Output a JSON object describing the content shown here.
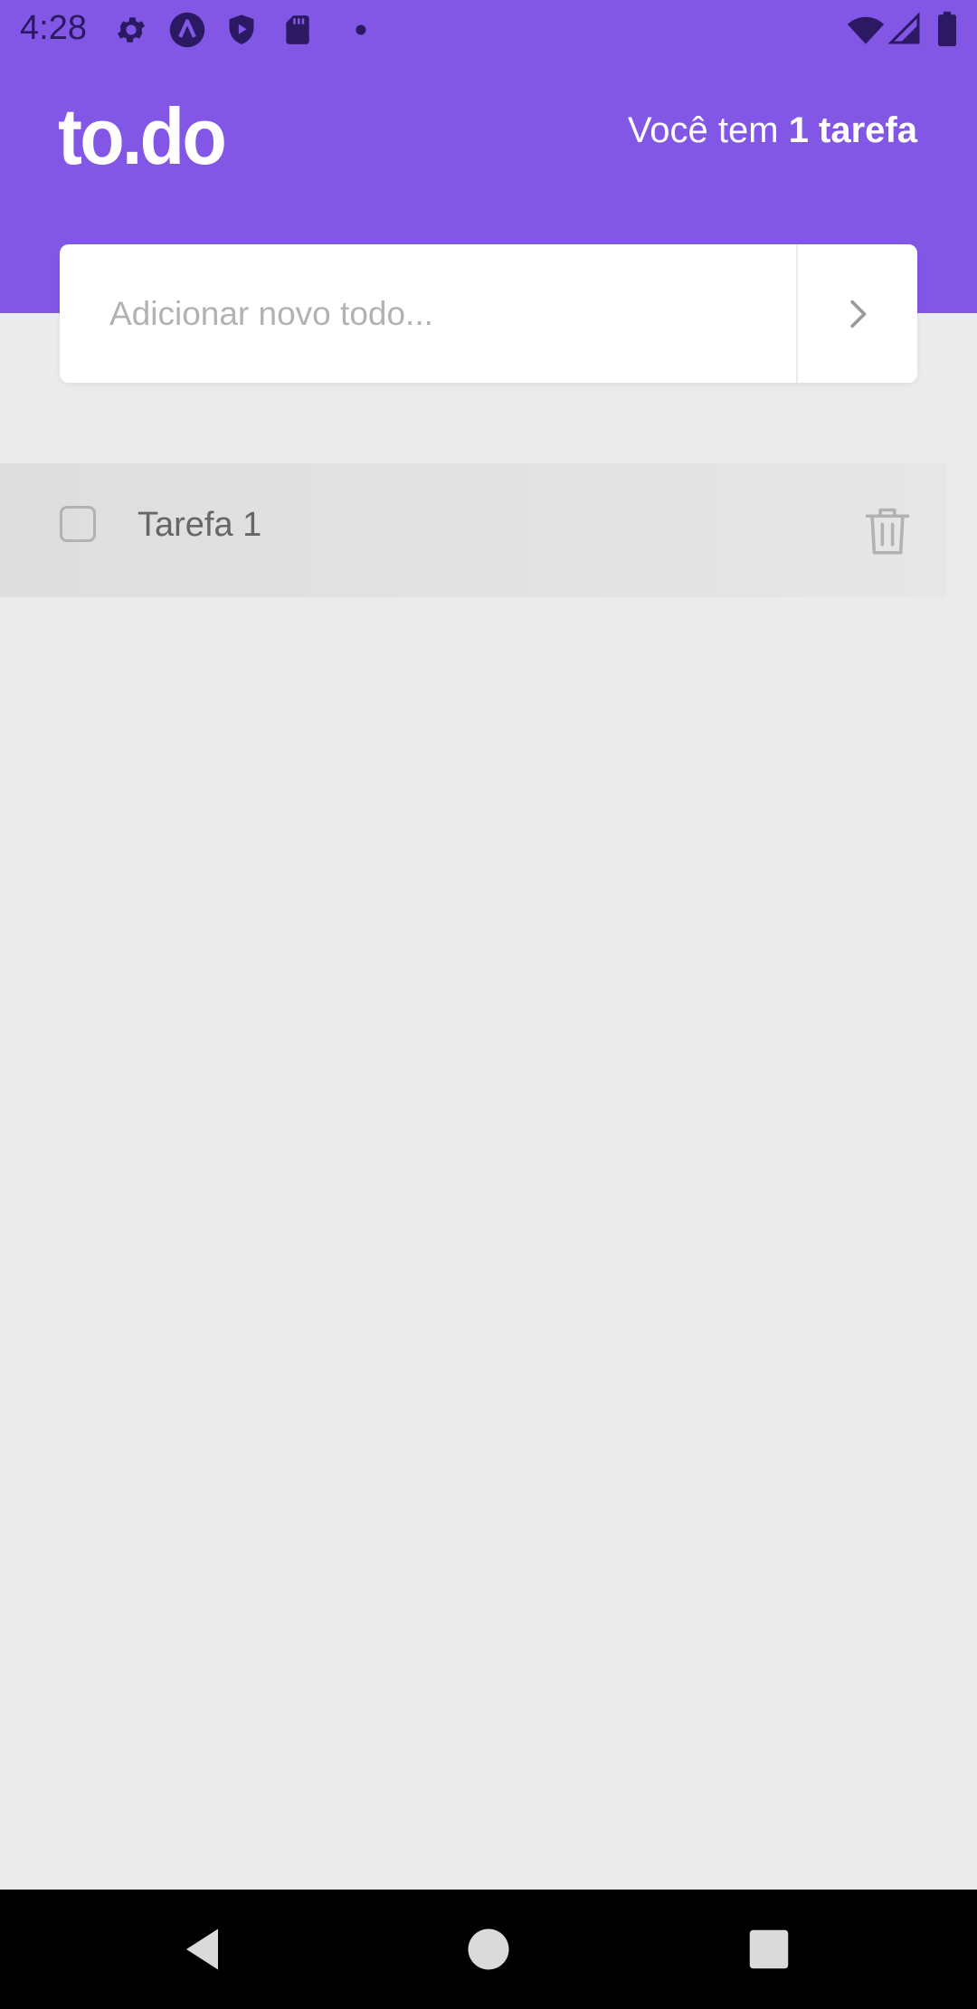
{
  "status_bar": {
    "time": "4:28",
    "left_icons": [
      "gear-icon",
      "a-circle-icon",
      "shield-play-icon",
      "sd-card-icon",
      "dot-icon"
    ],
    "right_icons": [
      "wifi-icon",
      "cell-signal-icon",
      "battery-icon"
    ]
  },
  "header": {
    "logo": "to.do",
    "counter_prefix": "Você tem ",
    "counter_count": "1 tarefa",
    "background_color": "#8257E5"
  },
  "new_todo": {
    "placeholder": "Adicionar novo todo...",
    "value": "",
    "submit_icon": "chevron-right-icon"
  },
  "tasks": [
    {
      "label": "Tarefa 1",
      "done": false,
      "delete_icon": "trash-icon"
    }
  ],
  "nav_bar": {
    "buttons": [
      "back-icon",
      "home-icon",
      "recents-icon"
    ]
  }
}
